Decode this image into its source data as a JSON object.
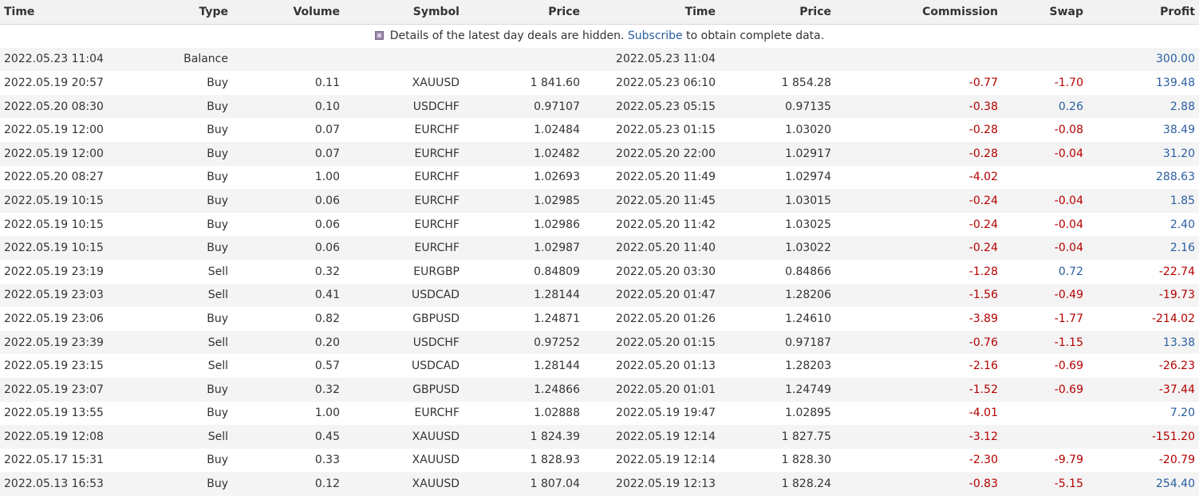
{
  "headers": [
    "Time",
    "Type",
    "Volume",
    "Symbol",
    "Price",
    "Time",
    "Price",
    "Commission",
    "Swap",
    "Profit"
  ],
  "notice": {
    "before": "Details of the latest day deals are hidden.",
    "link": "Subscribe",
    "after": "to obtain complete data."
  },
  "icons": {
    "notice_icon": "lock-icon"
  },
  "colors": {
    "negative": "#b50000",
    "positive": "#2a5ea0",
    "header_bg": "#f2f2f2",
    "stripe_bg": "#f4f4f4"
  },
  "rows": [
    [
      "2022.05.23 11:04",
      "Balance",
      "",
      "",
      "",
      "2022.05.23 11:04",
      "",
      "",
      "",
      "300.00"
    ],
    [
      "2022.05.19 20:57",
      "Buy",
      "0.11",
      "XAUUSD",
      "1 841.60",
      "2022.05.23 06:10",
      "1 854.28",
      "-0.77",
      "-1.70",
      "139.48"
    ],
    [
      "2022.05.20 08:30",
      "Buy",
      "0.10",
      "USDCHF",
      "0.97107",
      "2022.05.23 05:15",
      "0.97135",
      "-0.38",
      "0.26",
      "2.88"
    ],
    [
      "2022.05.19 12:00",
      "Buy",
      "0.07",
      "EURCHF",
      "1.02484",
      "2022.05.23 01:15",
      "1.03020",
      "-0.28",
      "-0.08",
      "38.49"
    ],
    [
      "2022.05.19 12:00",
      "Buy",
      "0.07",
      "EURCHF",
      "1.02482",
      "2022.05.20 22:00",
      "1.02917",
      "-0.28",
      "-0.04",
      "31.20"
    ],
    [
      "2022.05.20 08:27",
      "Buy",
      "1.00",
      "EURCHF",
      "1.02693",
      "2022.05.20 11:49",
      "1.02974",
      "-4.02",
      "",
      "288.63"
    ],
    [
      "2022.05.19 10:15",
      "Buy",
      "0.06",
      "EURCHF",
      "1.02985",
      "2022.05.20 11:45",
      "1.03015",
      "-0.24",
      "-0.04",
      "1.85"
    ],
    [
      "2022.05.19 10:15",
      "Buy",
      "0.06",
      "EURCHF",
      "1.02986",
      "2022.05.20 11:42",
      "1.03025",
      "-0.24",
      "-0.04",
      "2.40"
    ],
    [
      "2022.05.19 10:15",
      "Buy",
      "0.06",
      "EURCHF",
      "1.02987",
      "2022.05.20 11:40",
      "1.03022",
      "-0.24",
      "-0.04",
      "2.16"
    ],
    [
      "2022.05.19 23:19",
      "Sell",
      "0.32",
      "EURGBP",
      "0.84809",
      "2022.05.20 03:30",
      "0.84866",
      "-1.28",
      "0.72",
      "-22.74"
    ],
    [
      "2022.05.19 23:03",
      "Sell",
      "0.41",
      "USDCAD",
      "1.28144",
      "2022.05.20 01:47",
      "1.28206",
      "-1.56",
      "-0.49",
      "-19.73"
    ],
    [
      "2022.05.19 23:06",
      "Buy",
      "0.82",
      "GBPUSD",
      "1.24871",
      "2022.05.20 01:26",
      "1.24610",
      "-3.89",
      "-1.77",
      "-214.02"
    ],
    [
      "2022.05.19 23:39",
      "Sell",
      "0.20",
      "USDCHF",
      "0.97252",
      "2022.05.20 01:15",
      "0.97187",
      "-0.76",
      "-1.15",
      "13.38"
    ],
    [
      "2022.05.19 23:15",
      "Sell",
      "0.57",
      "USDCAD",
      "1.28144",
      "2022.05.20 01:13",
      "1.28203",
      "-2.16",
      "-0.69",
      "-26.23"
    ],
    [
      "2022.05.19 23:07",
      "Buy",
      "0.32",
      "GBPUSD",
      "1.24866",
      "2022.05.20 01:01",
      "1.24749",
      "-1.52",
      "-0.69",
      "-37.44"
    ],
    [
      "2022.05.19 13:55",
      "Buy",
      "1.00",
      "EURCHF",
      "1.02888",
      "2022.05.19 19:47",
      "1.02895",
      "-4.01",
      "",
      "7.20"
    ],
    [
      "2022.05.19 12:08",
      "Sell",
      "0.45",
      "XAUUSD",
      "1 824.39",
      "2022.05.19 12:14",
      "1 827.75",
      "-3.12",
      "",
      "-151.20"
    ],
    [
      "2022.05.17 15:31",
      "Buy",
      "0.33",
      "XAUUSD",
      "1 828.93",
      "2022.05.19 12:14",
      "1 828.30",
      "-2.30",
      "-9.79",
      "-20.79"
    ],
    [
      "2022.05.13 16:53",
      "Buy",
      "0.12",
      "XAUUSD",
      "1 807.04",
      "2022.05.19 12:13",
      "1 828.24",
      "-0.83",
      "-5.15",
      "254.40"
    ]
  ]
}
